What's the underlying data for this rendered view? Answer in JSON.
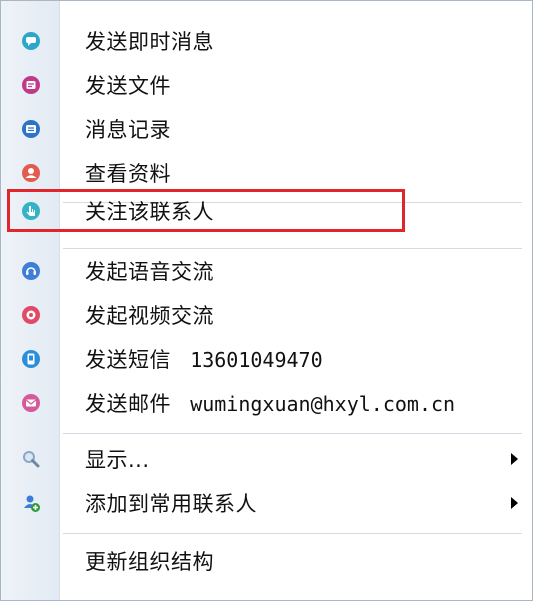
{
  "menu": {
    "groups": [
      {
        "items": [
          {
            "label": "发送即时消息",
            "icon": "chat-icon",
            "color": "#2ea6c8"
          },
          {
            "label": "发送文件",
            "icon": "file-icon",
            "color": "#c03a8a"
          },
          {
            "label": "消息记录",
            "icon": "history-icon",
            "color": "#2d73c7"
          },
          {
            "label": "查看资料",
            "icon": "profile-icon",
            "color": "#e25b4e"
          }
        ]
      },
      {
        "items": [
          {
            "label": "关注该联系人",
            "icon": "hand-icon",
            "color": "#35b3c6",
            "highlighted": true
          }
        ]
      },
      {
        "items": [
          {
            "label": "发起语音交流",
            "icon": "voice-icon",
            "color": "#3f7ed8"
          },
          {
            "label": "发起视频交流",
            "icon": "video-icon",
            "color": "#e04a68"
          },
          {
            "label": "发送短信",
            "extra": "13601049470",
            "icon": "sms-icon",
            "color": "#2a8fd8"
          },
          {
            "label": "发送邮件",
            "extra": "wumingxuan@hxyl.com.cn",
            "icon": "mail-icon",
            "color": "#d65a9a"
          }
        ]
      },
      {
        "items": [
          {
            "label": "显示...",
            "icon": "magnifier-icon",
            "color": "#8aa7c8",
            "submenu": true
          },
          {
            "label": "添加到常用联系人",
            "icon": "add-contact-icon",
            "color": "#2f9a3e",
            "submenu": true
          }
        ]
      },
      {
        "items": [
          {
            "label": "更新组织结构",
            "icon": "",
            "color": ""
          }
        ]
      }
    ]
  },
  "colors": {
    "highlight_border": "#e0262a",
    "gutter": "#e6edf5",
    "separator": "#d3dbe5"
  }
}
